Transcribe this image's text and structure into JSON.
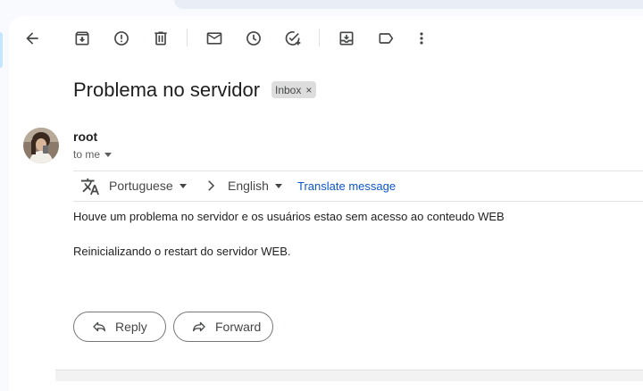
{
  "email": {
    "subject": "Problema no servidor",
    "label": "Inbox",
    "label_remove": "×",
    "sender": "root",
    "recipient": "to me",
    "body": [
      "Houve um problema no servidor e os usuários estao sem acesso ao conteudo WEB",
      "Reinicializando o restart do servidor WEB."
    ]
  },
  "translate": {
    "source_lang": "Portuguese",
    "target_lang": "English",
    "action": "Translate message"
  },
  "actions": {
    "reply": "Reply",
    "forward": "Forward"
  },
  "toolbar_icons": [
    "back-arrow-icon",
    "archive-icon",
    "report-spam-icon",
    "delete-icon",
    "mark-unread-icon",
    "snooze-icon",
    "add-task-icon",
    "move-to-icon",
    "label-icon",
    "more-vert-icon"
  ],
  "colors": {
    "link": "#0b57d0",
    "label_chip": "#dddddd",
    "background": "#f8fafd"
  }
}
